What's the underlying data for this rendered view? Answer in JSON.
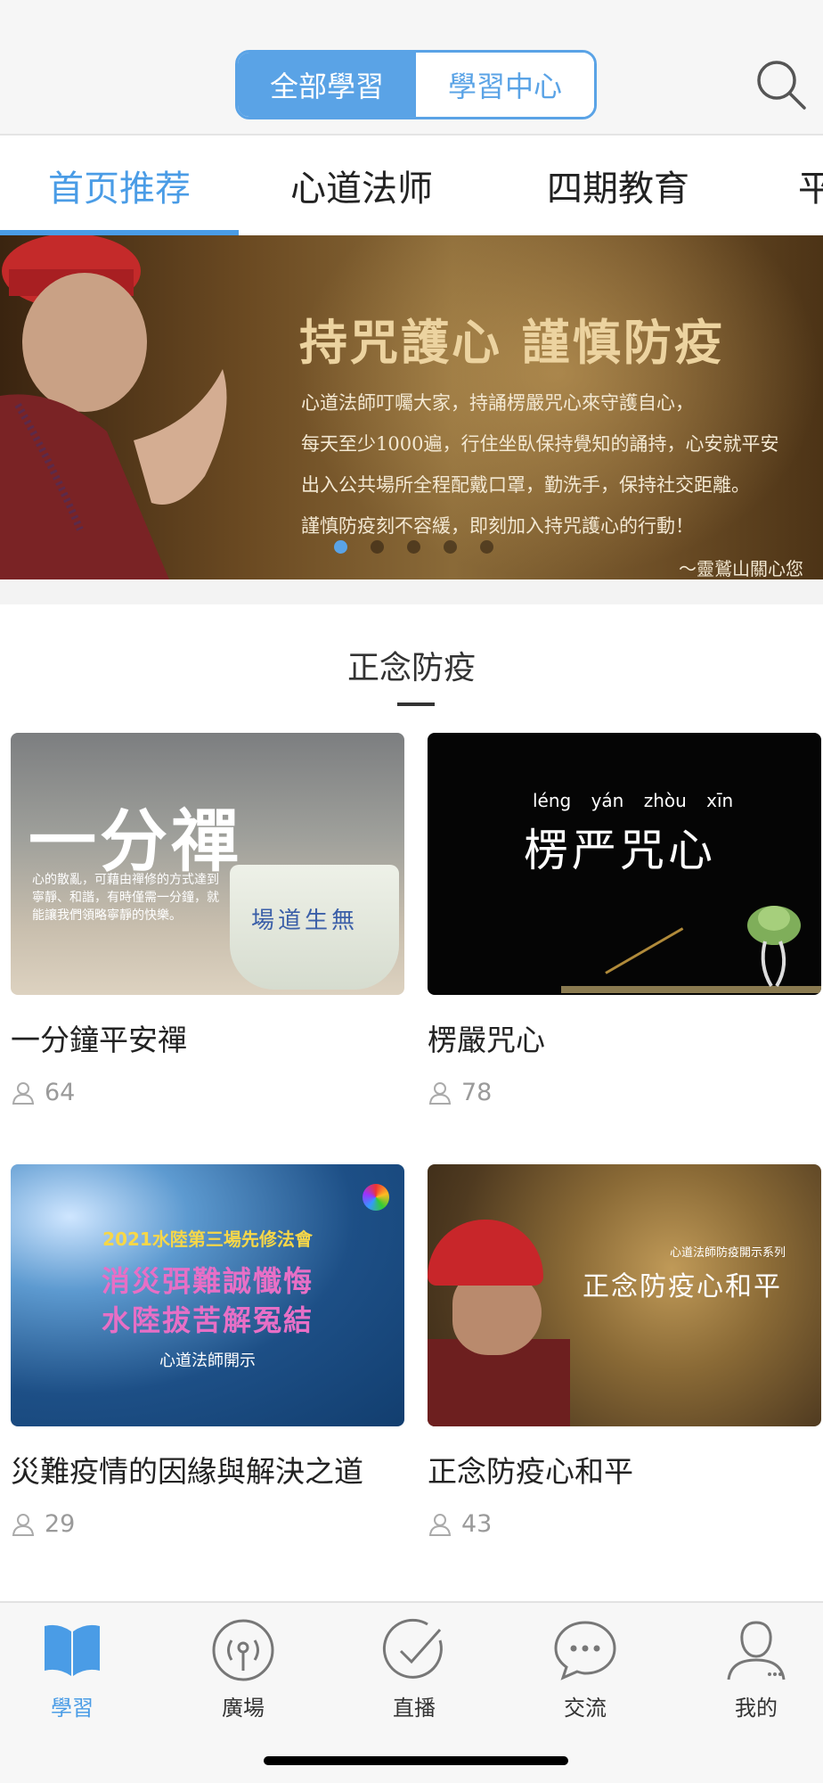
{
  "header": {
    "segments": [
      {
        "label": "全部學習",
        "active": true
      },
      {
        "label": "學習中心",
        "active": false
      }
    ],
    "search_icon": "search-icon"
  },
  "tabs": [
    {
      "label": "首页推荐",
      "active": true
    },
    {
      "label": "心道法师",
      "active": false
    },
    {
      "label": "四期教育",
      "active": false
    },
    {
      "label": "平",
      "active": false
    }
  ],
  "banner": {
    "title": "持咒護心  謹慎防疫",
    "lines": [
      "心道法師叮囑大家，持誦楞嚴咒心來守護自心，",
      "每天至少1000遍，行住坐臥保持覺知的誦持，心安就平安",
      "出入公共場所全程配戴口罩，勤洗手，保持社交距離。",
      "謹慎防疫刻不容緩，即刻加入持咒護心的行動！"
    ],
    "signature": "～靈鷲山關心您",
    "slide_count": 5,
    "active_slide": 1
  },
  "section": {
    "title": "正念防疫"
  },
  "cards": [
    {
      "title": "一分鐘平安禪",
      "views": "64",
      "thumb": {
        "big": "一分禪",
        "small": "心的散亂，可藉由禪修的方式達到寧靜、和諧，有時僅需一分鐘，就能讓我們領略寧靜的快樂。",
        "cup_text": "場道生無"
      }
    },
    {
      "title": "楞嚴咒心",
      "views": "78",
      "thumb": {
        "pinyin": "léng yán zhòu xīn",
        "big": "楞严咒心"
      }
    },
    {
      "title": "災難疫情的因緣與解決之道",
      "views": "29",
      "thumb": {
        "year": "2021水陸第三場先修法會",
        "line1": "消災弭難誠懺悔",
        "line2": "水陸拔苦解冤結",
        "sub": "心道法師開示"
      }
    },
    {
      "title": "正念防疫心和平",
      "views": "43",
      "thumb": {
        "sub": "心道法師防疫開示系列",
        "big": "正念防疫心和平"
      }
    }
  ],
  "tabbar": [
    {
      "label": "學習",
      "icon": "book-icon",
      "active": true
    },
    {
      "label": "廣場",
      "icon": "broadcast-icon",
      "active": false
    },
    {
      "label": "直播",
      "icon": "check-circle-icon",
      "active": false
    },
    {
      "label": "交流",
      "icon": "chat-bubble-icon",
      "active": false
    },
    {
      "label": "我的",
      "icon": "user-icon",
      "active": false
    }
  ],
  "colors": {
    "accent": "#4a9ce6",
    "segment": "#5aa3e6",
    "text": "#222222",
    "muted": "#9a9a9a"
  }
}
